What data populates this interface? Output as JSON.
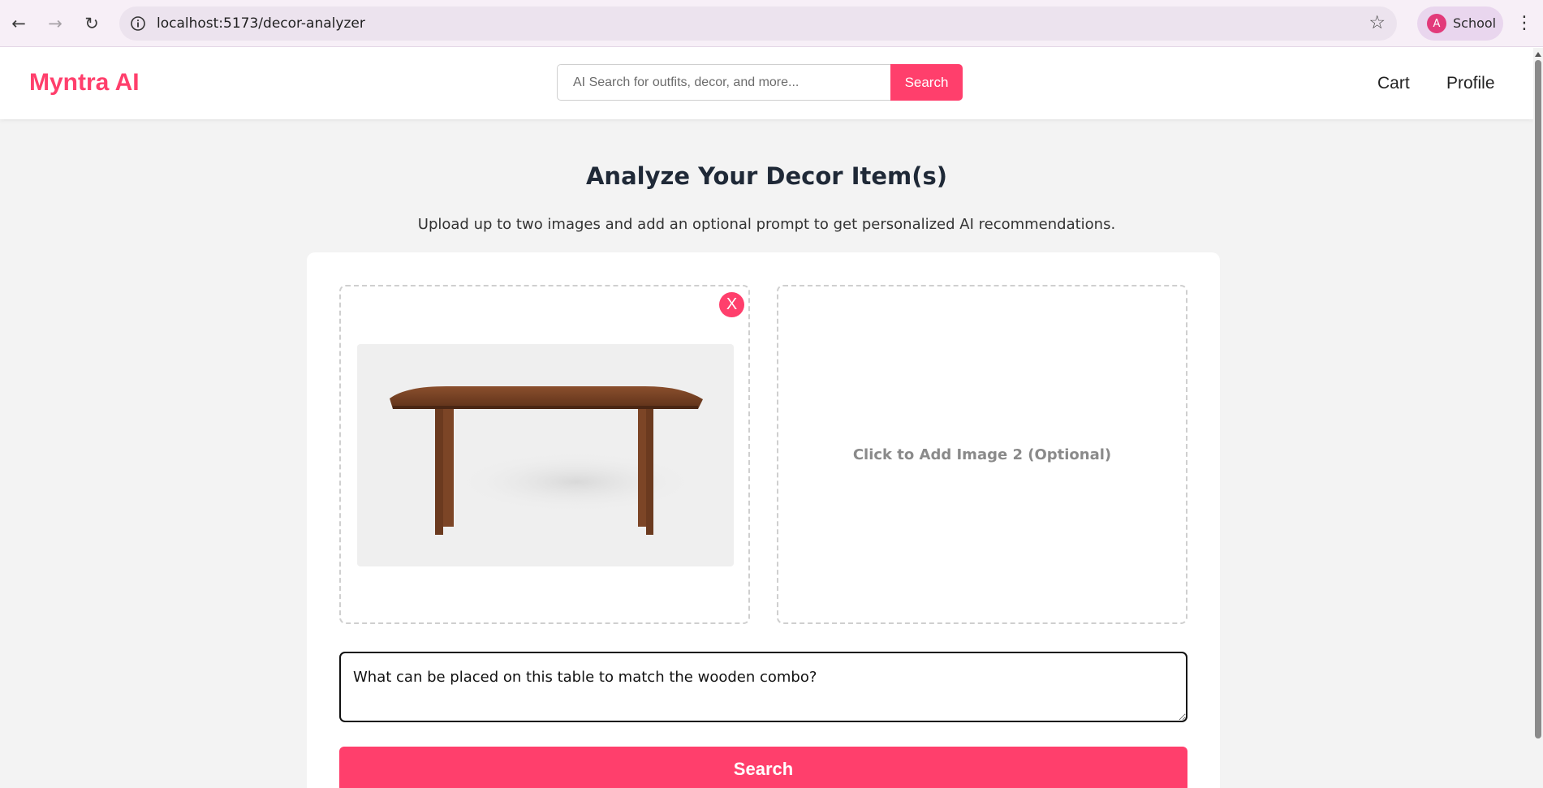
{
  "browser": {
    "url": "localhost:5173/decor-analyzer",
    "profile_initial": "A",
    "profile_name": "School",
    "back_icon": "←",
    "forward_icon": "→",
    "reload_icon": "↻",
    "bookmark_icon": "☆",
    "menu_icon": "⋮"
  },
  "header": {
    "brand": "Myntra AI",
    "search_placeholder": "AI Search for outfits, decor, and more...",
    "search_button": "Search",
    "nav": [
      "Cart",
      "Profile"
    ]
  },
  "main": {
    "title": "Analyze Your Decor Item(s)",
    "subtitle": "Upload up to two images and add an optional prompt to get personalized AI recommendations.",
    "image1": {
      "remove_label": "X",
      "alt": "Wooden table"
    },
    "image2": {
      "add_label": "Click to Add Image 2 (Optional)"
    },
    "prompt_value": "What can be placed on this table to match the wooden combo?",
    "submit_label": "Search"
  },
  "colors": {
    "accent": "#ff3f6c",
    "page_bg": "#f3f3f3",
    "chrome_bg": "#f7eff7"
  }
}
